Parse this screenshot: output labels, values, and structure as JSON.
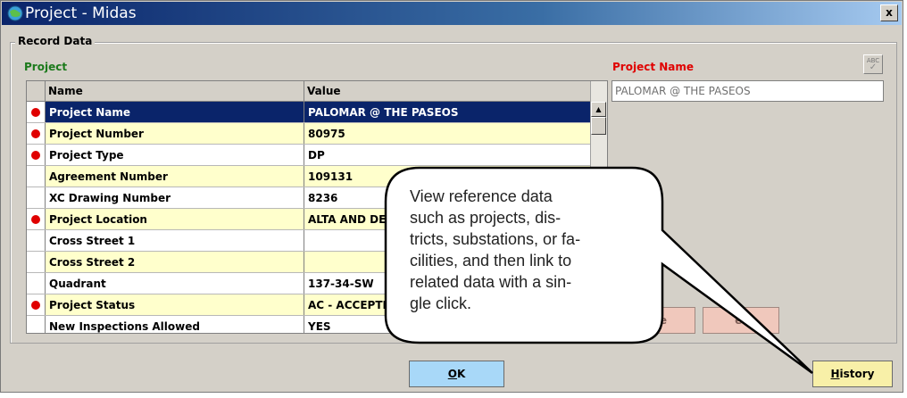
{
  "window": {
    "title": "Project - Midas",
    "close_label": "x"
  },
  "groupbox": {
    "legend": "Record Data"
  },
  "project_section": {
    "label": "Project",
    "color": "#1c7a1c"
  },
  "project_name_section": {
    "label": "Project Name",
    "color": "#e00000",
    "value": "PALOMAR @ THE PASEOS",
    "abc_label": "ABC"
  },
  "grid": {
    "columns": [
      "Name",
      "Value"
    ],
    "rows": [
      {
        "required": true,
        "name": "Project Name",
        "value": "PALOMAR @ THE PASEOS",
        "style": "selected"
      },
      {
        "required": true,
        "name": "Project Number",
        "value": "80975",
        "style": "yellow"
      },
      {
        "required": true,
        "name": "Project Type",
        "value": "DP",
        "style": "white"
      },
      {
        "required": false,
        "name": "Agreement Number",
        "value": "109131",
        "style": "yellow"
      },
      {
        "required": false,
        "name": "XC Drawing Number",
        "value": "8236",
        "style": "white"
      },
      {
        "required": true,
        "name": "Project Location",
        "value": "ALTA AND DE",
        "style": "yellow"
      },
      {
        "required": false,
        "name": "Cross Street 1",
        "value": "",
        "style": "white"
      },
      {
        "required": false,
        "name": "Cross Street 2",
        "value": "",
        "style": "yellow"
      },
      {
        "required": false,
        "name": "Quadrant",
        "value": "137-34-SW",
        "style": "white"
      },
      {
        "required": true,
        "name": "Project Status",
        "value": "AC - ACCEPTE",
        "style": "yellow"
      },
      {
        "required": false,
        "name": "New Inspections Allowed",
        "value": "YES",
        "style": "white"
      }
    ]
  },
  "buttons": {
    "ok": {
      "label": "OK",
      "accel": "O",
      "rest": "K"
    },
    "history": {
      "label": "History",
      "accel": "H",
      "rest": "istory"
    },
    "partial_left": {
      "label": "e"
    },
    "partial_right": {
      "label": "et"
    }
  },
  "callout": {
    "lines": [
      "View reference data",
      "such as projects, dis-",
      "tricts, substations, or fa-",
      "cilities, and then link to",
      "related data with a sin-",
      "gle click."
    ]
  },
  "colors": {
    "selection": "#0a246a",
    "row_highlight": "#ffffcc",
    "required_dot": "#e00000",
    "ok_button": "#a8d8f8",
    "history_button": "#f8f0a8"
  }
}
